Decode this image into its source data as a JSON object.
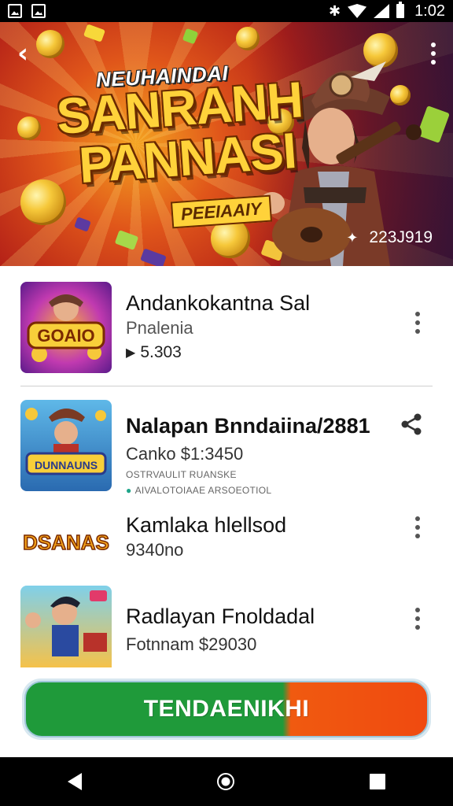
{
  "status_bar": {
    "time": "1:02",
    "left_icons": [
      "gallery-notification-icon",
      "image-notification-icon"
    ],
    "right_icons": [
      "bluetooth-icon",
      "wifi-icon",
      "signal-icon",
      "battery-icon"
    ]
  },
  "hero": {
    "subtitle": "NEUHAINDAI",
    "title_line1": "SANRANH",
    "title_line2": "PANNASI",
    "tag": "PEEIAAIY",
    "count": "223J919"
  },
  "list": {
    "items": [
      {
        "title": "Andankokantna Sal",
        "subtitle": "Pnalenia",
        "meta": "5.303",
        "thumb_text": "GOAIO"
      },
      {
        "title": "Nalapan Bnndaiina/2881",
        "subtitle": "Canko  $1:3450",
        "tiny1": "OSTRVAULIT RUANSKE",
        "tiny2": "AIVALOTOIAAE ARSOEOTIOL",
        "thumb_text": "DUNNAUNS"
      },
      {
        "title": "Kamlaka hlellsod",
        "subtitle": "9340no",
        "thumb_text": "DSANAS"
      },
      {
        "title": "Radlayan Fnoldadal",
        "subtitle": "Fotnnam  $29030"
      }
    ]
  },
  "cta": {
    "label": "TENDAENIKHI"
  },
  "colors": {
    "cta_green": "#1f9a3a",
    "cta_orange": "#f05a10",
    "hero_red": "#b21e17",
    "gold": "#ffd23a"
  }
}
